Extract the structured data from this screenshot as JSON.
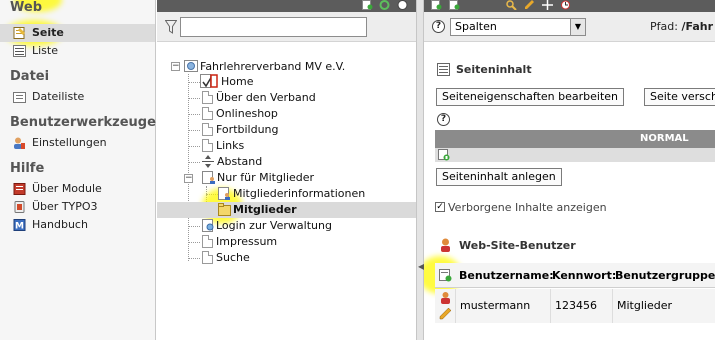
{
  "module_menu": {
    "groups": [
      {
        "title": "Web",
        "items": [
          {
            "label": "Seite",
            "active": true
          },
          {
            "label": "Liste",
            "active": false
          }
        ]
      },
      {
        "title": "Datei",
        "items": [
          {
            "label": "Dateiliste",
            "active": false
          }
        ]
      },
      {
        "title": "Benutzerwerkzeuge",
        "items": [
          {
            "label": "Einstellungen",
            "active": false
          }
        ]
      },
      {
        "title": "Hilfe",
        "items": [
          {
            "label": "Über Module",
            "active": false
          },
          {
            "label": "Über TYPO3",
            "active": false
          },
          {
            "label": "Handbuch",
            "active": false
          }
        ]
      }
    ]
  },
  "page_tree": {
    "root": "Fahrlehrerverband MV e.V.",
    "nodes": [
      {
        "label": "Home"
      },
      {
        "label": "Über den Verband"
      },
      {
        "label": "Onlineshop"
      },
      {
        "label": "Fortbildung"
      },
      {
        "label": "Links"
      },
      {
        "label": "Abstand"
      },
      {
        "label": "Nur für Mitglieder"
      },
      {
        "label": "Mitgliederinformationen"
      },
      {
        "label": "Mitglieder",
        "selected": true
      },
      {
        "label": "Login zur Verwaltung"
      },
      {
        "label": "Impressum"
      },
      {
        "label": "Suche"
      }
    ]
  },
  "content": {
    "mode_select": "Spalten",
    "path_label": "Pfad:",
    "path_value": "/Fahr",
    "page_content_title": "Seiteninhalt",
    "btn_page_properties": "Seiteneigenschaften bearbeiten",
    "btn_page_preview": "Seite versch",
    "column_header": "NORMAL",
    "btn_create_content": "Seiteninhalt anlegen",
    "hidden_checkbox_label": "Verborgene Inhalte anzeigen",
    "web_user_title": "Web-Site-Benutzer",
    "user_table": {
      "headers": [
        "Benutzername:",
        "Kennwort:",
        "Benutzergruppe:"
      ],
      "rows": [
        [
          "mustermann",
          "123456",
          "Mitglieder"
        ]
      ]
    }
  },
  "colors": {
    "highlight": "#fffa00",
    "topbar": "#5c5c5c",
    "column_header": "#8b8b8b",
    "active_menu": "#dcdcdc"
  }
}
